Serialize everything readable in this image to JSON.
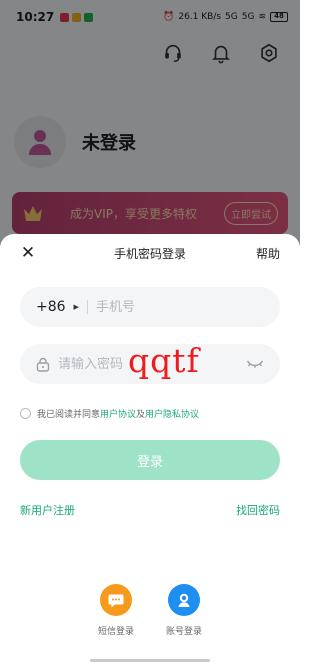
{
  "status_bar": {
    "time": "10:27",
    "net_speed": "26.1 KB/s",
    "signal1": "5G",
    "signal2": "5G",
    "battery": "48"
  },
  "profile": {
    "login_status": "未登录"
  },
  "vip_banner": {
    "text": "成为VIP，享受更多特权",
    "button_label": "立即尝试"
  },
  "sheet": {
    "title": "手机密码登录",
    "help_label": "帮助",
    "phone_field": {
      "country_code": "+86",
      "placeholder": "手机号"
    },
    "password_field": {
      "placeholder": "请输入密码",
      "handwritten_overlay": "qqtf"
    },
    "agreement": {
      "prefix": "我已阅读并同意",
      "user_agreement": "用户协议",
      "conjunction": "及",
      "privacy_agreement": "用户隐私协议"
    },
    "login_button": "登录",
    "register_link": "新用户注册",
    "recover_link": "找回密码",
    "alt_logins": [
      {
        "label": "短信登录",
        "icon": "message-icon",
        "color": "#f59a1b"
      },
      {
        "label": "账号登录",
        "icon": "account-icon",
        "color": "#1f8ef1"
      }
    ]
  },
  "colors": {
    "accent_green": "#1aa87a",
    "login_button_bg": "#9ee3c8"
  }
}
